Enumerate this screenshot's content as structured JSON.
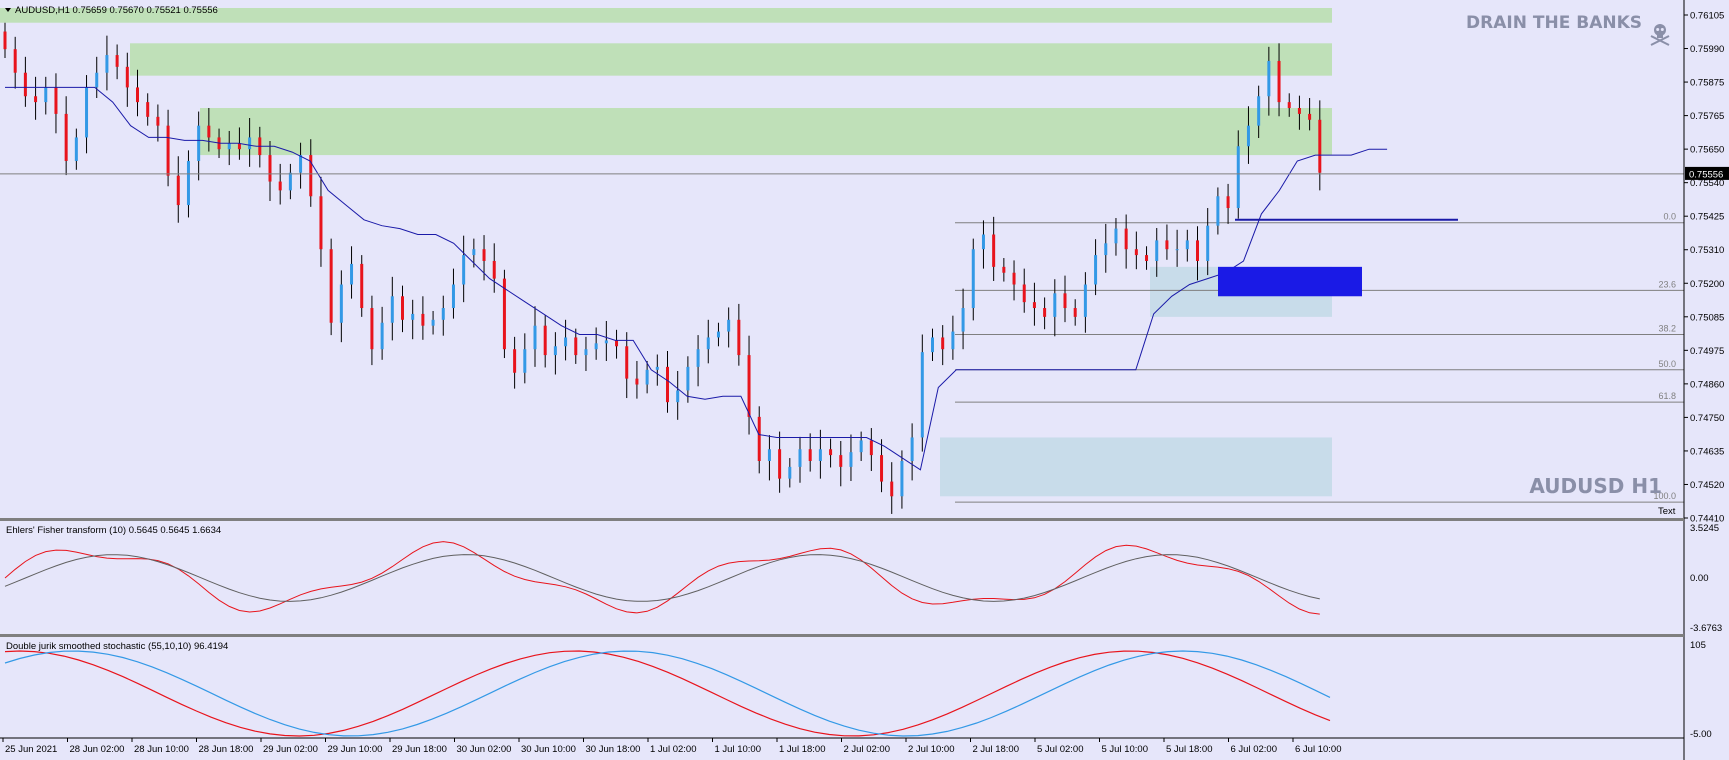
{
  "symbol_header": "AUDUSD,H1  0.75659 0.75670 0.75521 0.75556",
  "watermark_top": "DRAIN THE BANKS",
  "watermark_bottom": "AUDUSD H1",
  "text_object": "Text",
  "current_price_label": "0.75556",
  "colors": {
    "background": "#e6e6fa",
    "bull_candle": "#3399e6",
    "bear_candle": "#e8141c",
    "supply_zone": "#bfe0b8",
    "demand_zone": "#c8dcea",
    "trend_line": "#1a1aa8",
    "box_blue": "#1a1ae6"
  },
  "price_axis": [
    "0.76105",
    "0.75990",
    "0.75875",
    "0.75765",
    "0.75650",
    "0.75540",
    "0.75425",
    "0.75310",
    "0.75200",
    "0.75085",
    "0.74975",
    "0.74860",
    "0.74750",
    "0.74635",
    "0.74520",
    "0.74410"
  ],
  "fib_levels": [
    "0.0",
    "23.6",
    "38.2",
    "50.0",
    "61.8",
    "100.0"
  ],
  "time_axis": [
    "25 Jun 2021",
    "28 Jun 02:00",
    "28 Jun 10:00",
    "28 Jun 18:00",
    "29 Jun 02:00",
    "29 Jun 10:00",
    "29 Jun 18:00",
    "30 Jun 02:00",
    "30 Jun 10:00",
    "30 Jun 18:00",
    "1 Jul 02:00",
    "1 Jul 10:00",
    "1 Jul 18:00",
    "2 Jul 02:00",
    "2 Jul 10:00",
    "2 Jul 18:00",
    "5 Jul 02:00",
    "5 Jul 10:00",
    "5 Jul 18:00",
    "6 Jul 02:00",
    "6 Jul 10:00"
  ],
  "indicator1": {
    "label": "Ehlers' Fisher transform (10) 0.5645 0.5645 1.6634",
    "axis": [
      "3.5245",
      "0.00",
      "-3.6763"
    ]
  },
  "indicator2": {
    "label": "Double jurik smoothed stochastic (55,10,10) 96.4194",
    "axis": [
      "105",
      "-5.00"
    ]
  },
  "chart_data": {
    "type": "candlestick",
    "symbol": "AUDUSD",
    "timeframe": "H1",
    "last_ohlc": {
      "open": 0.75659,
      "high": 0.7567,
      "low": 0.75521,
      "close": 0.75556
    },
    "ylim": [
      0.7441,
      0.7612
    ],
    "closes": [
      0.7598,
      0.759,
      0.7582,
      0.758,
      0.7585,
      0.7576,
      0.756,
      0.7568,
      0.7585,
      0.759,
      0.7596,
      0.7592,
      0.7585,
      0.758,
      0.7575,
      0.7572,
      0.7555,
      0.7545,
      0.756,
      0.7572,
      0.7568,
      0.7564,
      0.7566,
      0.7564,
      0.7568,
      0.7562,
      0.7553,
      0.755,
      0.7556,
      0.7562,
      0.7548,
      0.753,
      0.7505,
      0.7518,
      0.7525,
      0.751,
      0.7496,
      0.7505,
      0.7514,
      0.7506,
      0.7508,
      0.7504,
      0.7506,
      0.751,
      0.7518,
      0.7528,
      0.753,
      0.7526,
      0.752,
      0.7496,
      0.7488,
      0.7496,
      0.7504,
      0.7494,
      0.7497,
      0.75,
      0.7494,
      0.7496,
      0.7498,
      0.7499,
      0.7497,
      0.7486,
      0.7484,
      0.7489,
      0.749,
      0.7478,
      0.7482,
      0.749,
      0.7496,
      0.75,
      0.7502,
      0.7506,
      0.7494,
      0.7473,
      0.7458,
      0.7462,
      0.7452,
      0.7456,
      0.7462,
      0.7458,
      0.7462,
      0.746,
      0.7456,
      0.7461,
      0.7465,
      0.746,
      0.7451,
      0.7446,
      0.7458,
      0.7466,
      0.7495,
      0.75,
      0.7496,
      0.7502,
      0.751,
      0.753,
      0.7535,
      0.7524,
      0.7522,
      0.7518,
      0.7512,
      0.751,
      0.7507,
      0.7515,
      0.751,
      0.7507,
      0.7518,
      0.7528,
      0.7532,
      0.7537,
      0.753,
      0.7528,
      0.7526,
      0.7533,
      0.753,
      0.753,
      0.7533,
      0.7526,
      0.7538,
      0.7548,
      0.7544,
      0.7565,
      0.7572,
      0.7582,
      0.7594,
      0.758,
      0.7578,
      0.7576,
      0.7574,
      0.7556
    ],
    "supertrend": [
      0.7585,
      0.7585,
      0.7585,
      0.7585,
      0.7585,
      0.7585,
      0.758,
      0.7572,
      0.7568,
      0.7568,
      0.7567,
      0.7567,
      0.7566,
      0.7566,
      0.7565,
      0.7565,
      0.7563,
      0.756,
      0.755,
      0.7545,
      0.754,
      0.7538,
      0.7537,
      0.7535,
      0.7535,
      0.7532,
      0.7526,
      0.752,
      0.7516,
      0.7512,
      0.7508,
      0.7504,
      0.7501,
      0.7501,
      0.7499,
      0.7499,
      0.7489,
      0.7485,
      0.748,
      0.7479,
      0.748,
      0.748,
      0.7467,
      0.7466,
      0.7466,
      0.7466,
      0.7466,
      0.7466,
      0.7466,
      0.7463,
      0.7459,
      0.7455,
      0.7483,
      0.7489,
      0.7489,
      0.7489,
      0.7489,
      0.7489,
      0.7489,
      0.7489,
      0.7489,
      0.7489,
      0.7489,
      0.7489,
      0.7508,
      0.7514,
      0.7518,
      0.752,
      0.7522,
      0.7526,
      0.7542,
      0.755,
      0.756,
      0.7562,
      0.7562,
      0.7562,
      0.7564,
      0.7564
    ],
    "zones": [
      {
        "kind": "supply",
        "top": 0.7612,
        "bottom": 0.7607
      },
      {
        "kind": "supply",
        "top": 0.76,
        "bottom": 0.7589
      },
      {
        "kind": "supply",
        "top": 0.7578,
        "bottom": 0.7562
      },
      {
        "kind": "demand",
        "top": 0.7524,
        "bottom": 0.7507
      },
      {
        "kind": "demand",
        "top": 0.7466,
        "bottom": 0.7446
      }
    ],
    "current_price": 0.75556,
    "fib_prices": [
      0.7539,
      0.7516,
      0.7501,
      0.7489,
      0.7478,
      0.7444
    ]
  }
}
